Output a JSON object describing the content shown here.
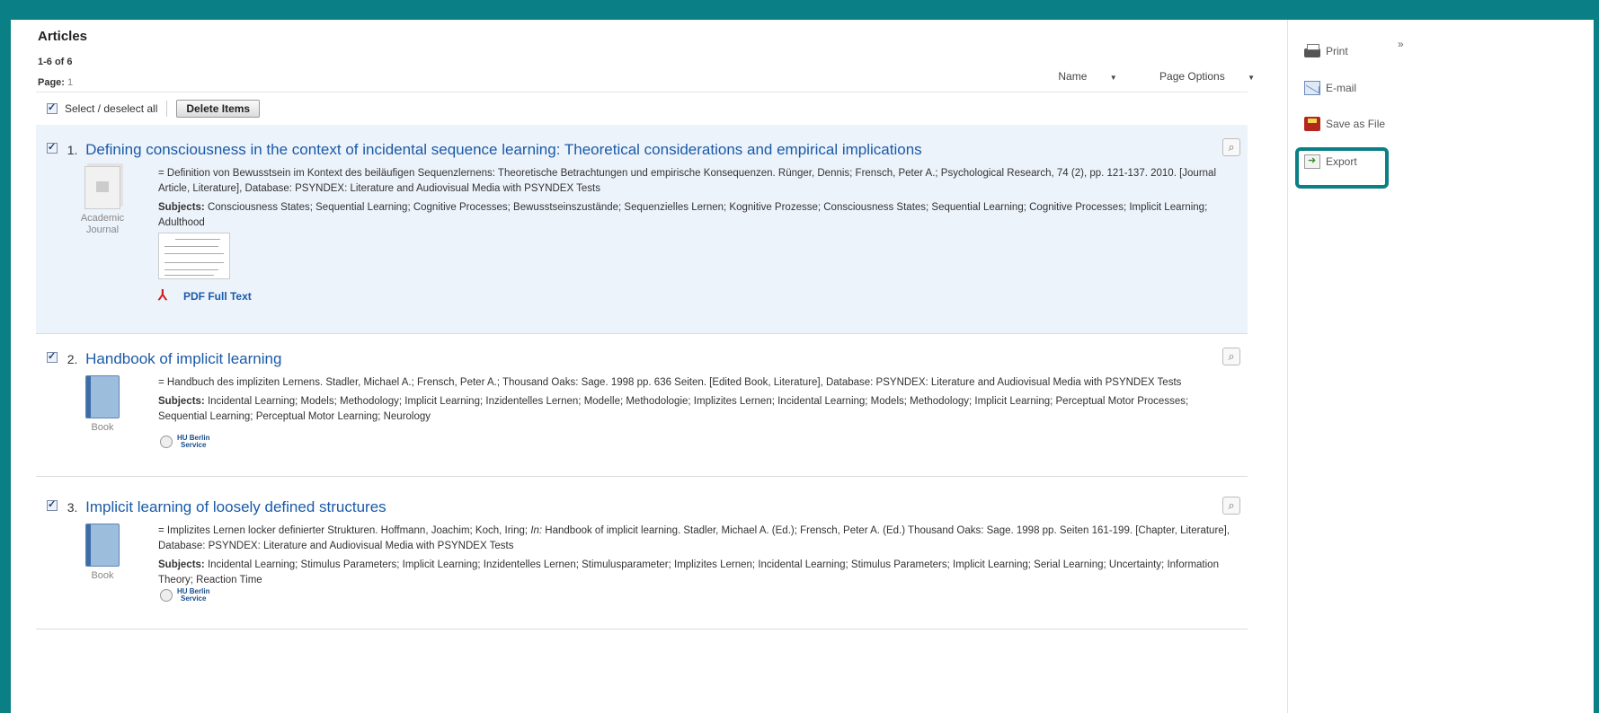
{
  "header": {
    "title": "Articles",
    "range": "1-6 of 6",
    "page_label": "Page:",
    "page_number": "1"
  },
  "sort_options": {
    "name_label": "Name",
    "page_options_label": "Page Options"
  },
  "toolbar": {
    "select_all_label": "Select / deselect all",
    "delete_label": "Delete Items"
  },
  "results": [
    {
      "number": "1.",
      "title": "Defining consciousness in the context of incidental sequence learning: Theoretical considerations and empirical implications",
      "description": "= Definition von Bewusstsein im Kontext des beiläufigen Sequenzlernens: Theoretische Betrachtungen und empirische Konsequenzen. Rünger, Dennis; Frensch, Peter A.; Psychological Research, 74 (2), pp. 121-137. 2010. [Journal Article, Literature], Database: PSYNDEX: Literature and Audiovisual Media with PSYNDEX Tests",
      "subjects_label": "Subjects:",
      "subjects": "Consciousness States; Sequential Learning; Cognitive Processes; Bewusstseinszustände; Sequenzielles Lernen; Kognitive Prozesse; Consciousness States; Sequential Learning; Cognitive Processes; Implicit Learning; Adulthood",
      "type_label": "Academic Journal",
      "pdf_label": "PDF Full Text"
    },
    {
      "number": "2.",
      "title": "Handbook of implicit learning",
      "description": "= Handbuch des impliziten Lernens. Stadler, Michael A.; Frensch, Peter A.; Thousand Oaks: Sage. 1998 pp. 636 Seiten. [Edited Book, Literature], Database: PSYNDEX: Literature and Audiovisual Media with PSYNDEX Tests",
      "subjects_label": "Subjects:",
      "subjects": "Incidental Learning; Models; Methodology; Implicit Learning; Inzidentelles Lernen; Modelle; Methodologie; Implizites Lernen; Incidental Learning; Models; Methodology; Implicit Learning; Perceptual Motor Processes; Sequential Learning; Perceptual Motor Learning; Neurology",
      "type_label": "Book",
      "badge_line1": "HU Berlin",
      "badge_line2": "Service"
    },
    {
      "number": "3.",
      "title": "Implicit learning of loosely defined structures",
      "description_pre": "= Implizites Lernen locker definierter Strukturen. Hoffmann, Joachim; Koch, Iring; ",
      "description_in": "In:",
      "description_post": " Handbook of implicit learning. Stadler, Michael A. (Ed.); Frensch, Peter A. (Ed.) Thousand Oaks: Sage. 1998 pp. Seiten 161-199. [Chapter, Literature], Database: PSYNDEX: Literature and Audiovisual Media with PSYNDEX Tests",
      "subjects_label": "Subjects:",
      "subjects": "Incidental Learning; Stimulus Parameters; Implicit Learning; Inzidentelles Lernen; Stimulusparameter; Implizites Lernen; Incidental Learning; Stimulus Parameters; Implicit Learning; Serial Learning; Uncertainty; Information Theory; Reaction Time",
      "type_label": "Book",
      "badge_line1": "HU Berlin",
      "badge_line2": "Service"
    }
  ],
  "tools": {
    "print_label": "Print",
    "email_label": "E-mail",
    "save_label": "Save as File",
    "export_label": "Export",
    "collapse_glyph": "»"
  },
  "colors": {
    "frame": "#0b7f86",
    "link": "#1a5aa8",
    "selected_row": "#edf3fb"
  }
}
